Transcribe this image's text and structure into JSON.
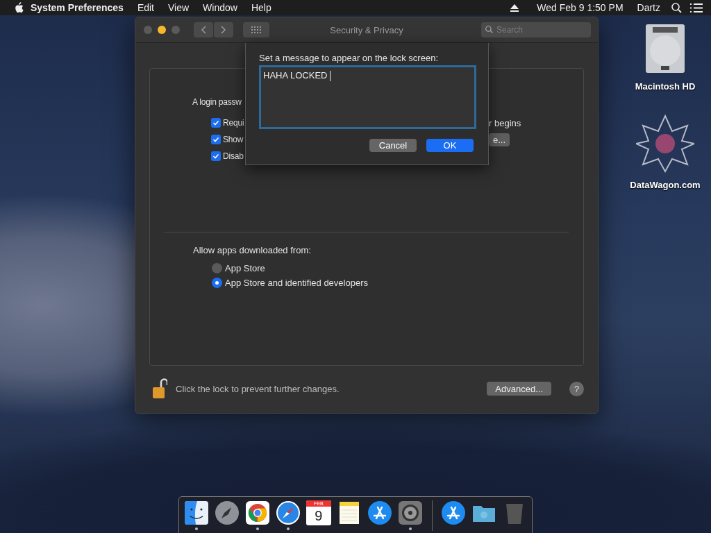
{
  "menu_bar": {
    "app_name": "System Preferences",
    "menus": [
      "Edit",
      "View",
      "Window",
      "Help"
    ],
    "clock": "Wed Feb 9  1:50 PM",
    "user": "Dartz"
  },
  "desktop_icons": [
    {
      "kind": "disk",
      "label": "Macintosh HD"
    },
    {
      "kind": "star",
      "label": "DataWagon.com"
    }
  ],
  "window": {
    "title": "Security & Privacy",
    "search": {
      "placeholder": "Search"
    },
    "login_section": {
      "text": "A login passw",
      "checkboxes": [
        {
          "label": "Requi",
          "trailing": "r begins",
          "checked": true
        },
        {
          "label": "Show",
          "button": "e...",
          "checked": true
        },
        {
          "label": "Disab",
          "checked": true
        }
      ]
    },
    "downloads_section": {
      "title": "Allow apps downloaded from:",
      "options": [
        {
          "label": "App Store",
          "selected": false
        },
        {
          "label": "App Store and identified developers",
          "selected": true
        }
      ]
    },
    "footer": {
      "locked": false,
      "text": "Click the lock to prevent further changes.",
      "advanced_button": "Advanced...",
      "help_button": "?"
    }
  },
  "sheet": {
    "label": "Set a message to appear on the lock screen:",
    "value": "HAHA LOCKED ",
    "buttons": [
      {
        "label": "Cancel",
        "primary": false
      },
      {
        "label": "OK",
        "primary": true
      }
    ]
  },
  "dock": [
    {
      "kind": "finder",
      "running": true
    },
    {
      "kind": "launchpad",
      "running": false
    },
    {
      "kind": "chrome",
      "running": true
    },
    {
      "kind": "safari",
      "running": true
    },
    {
      "kind": "calendar",
      "running": false,
      "month": "FEB",
      "day": "9"
    },
    {
      "kind": "notes",
      "running": false
    },
    {
      "kind": "appstore",
      "running": false
    },
    {
      "kind": "settings",
      "running": true
    },
    {
      "kind": "separator"
    },
    {
      "kind": "appstore",
      "running": false
    },
    {
      "kind": "folder",
      "running": false
    },
    {
      "kind": "trash",
      "running": false
    }
  ]
}
